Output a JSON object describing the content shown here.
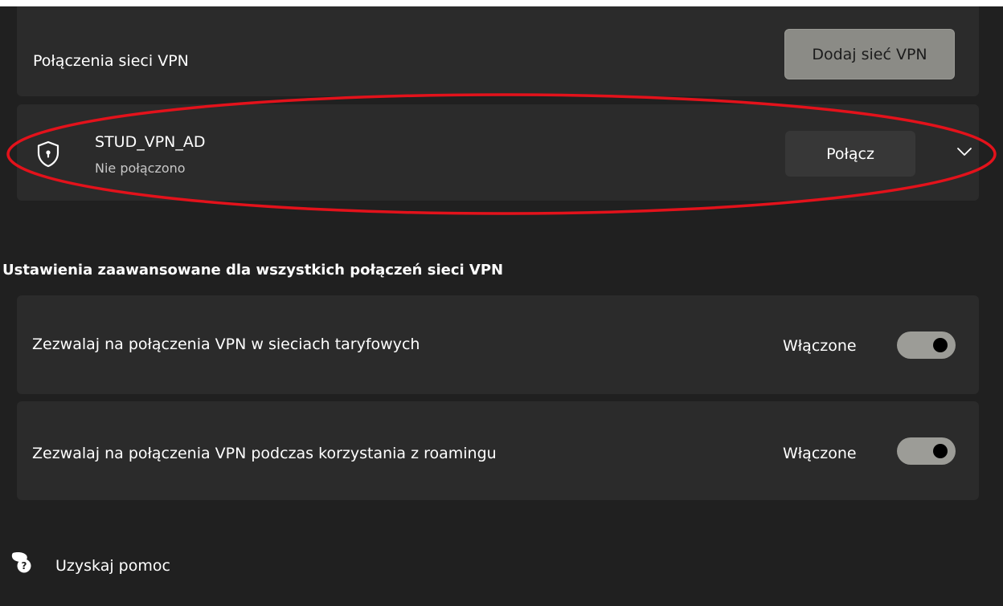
{
  "vpn_connections": {
    "title": "Połączenia sieci VPN",
    "add_button": "Dodaj sieć VPN"
  },
  "vpn_item": {
    "name": "STUD_VPN_AD",
    "status": "Nie połączono",
    "connect_button": "Połącz",
    "icon": "shield-lock-icon"
  },
  "advanced": {
    "heading": "Ustawienia zaawansowane dla wszystkich połączeń sieci VPN",
    "settings": [
      {
        "label": "Zezwalaj na połączenia VPN w sieciach taryfowych",
        "state": "Włączone",
        "on": true
      },
      {
        "label": "Zezwalaj na połączenia VPN podczas korzystania z roamingu",
        "state": "Włączone",
        "on": true
      }
    ]
  },
  "help": {
    "label": "Uzyskaj pomoc",
    "icon": "help-chat-icon"
  },
  "colors": {
    "background": "#202020",
    "card": "#2b2b2b",
    "add_button": "#8b8b86",
    "connect_button": "#373737",
    "toggle_track": "#9c9c97",
    "annotation_ellipse": "#e3121b"
  }
}
